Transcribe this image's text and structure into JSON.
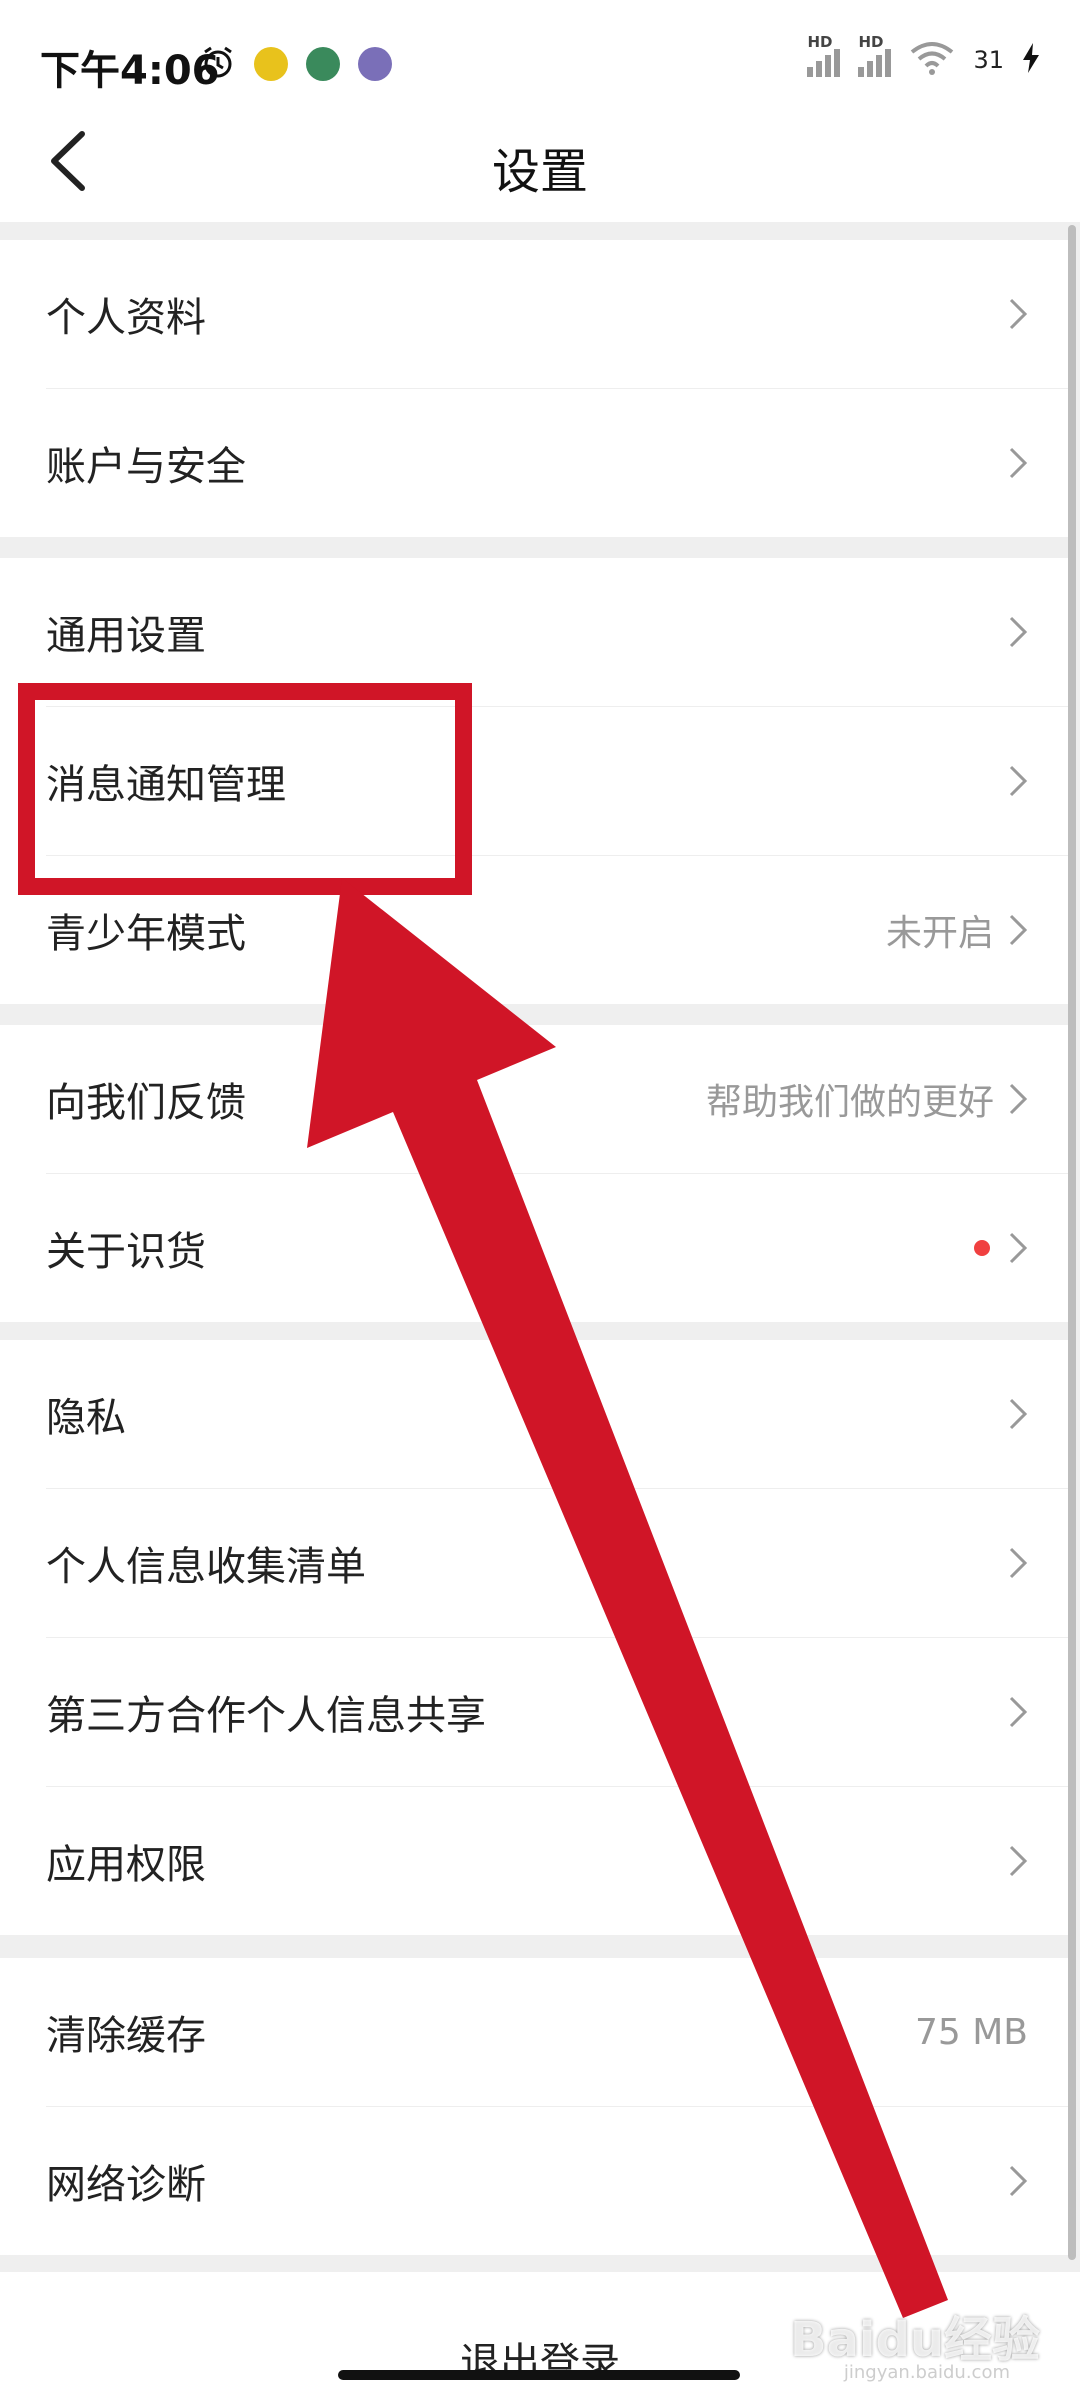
{
  "status_bar": {
    "time": "下午4:06",
    "battery": "31"
  },
  "header": {
    "title": "设置"
  },
  "groups": [
    {
      "items": [
        {
          "label": "个人资料"
        },
        {
          "label": "账户与安全"
        }
      ]
    },
    {
      "items": [
        {
          "label": "通用设置"
        },
        {
          "label": "消息通知管理"
        },
        {
          "label": "青少年模式",
          "value": "未开启"
        }
      ]
    },
    {
      "items": [
        {
          "label": "向我们反馈",
          "value": "帮助我们做的更好"
        },
        {
          "label": "关于识货",
          "badge": "red-dot"
        }
      ]
    },
    {
      "items": [
        {
          "label": "隐私"
        },
        {
          "label": "个人信息收集清单"
        },
        {
          "label": "第三方合作个人信息共享"
        },
        {
          "label": "应用权限"
        }
      ]
    },
    {
      "items": [
        {
          "label": "清除缓存",
          "value": "75 MB"
        },
        {
          "label": "网络诊断"
        }
      ]
    }
  ],
  "logout_label": "退出登录",
  "watermark": {
    "text": "Baidu经验",
    "sub": "jingyan.baidu.com"
  },
  "colors": {
    "annotation_red": "#d01527",
    "badge_red": "#f04040"
  }
}
